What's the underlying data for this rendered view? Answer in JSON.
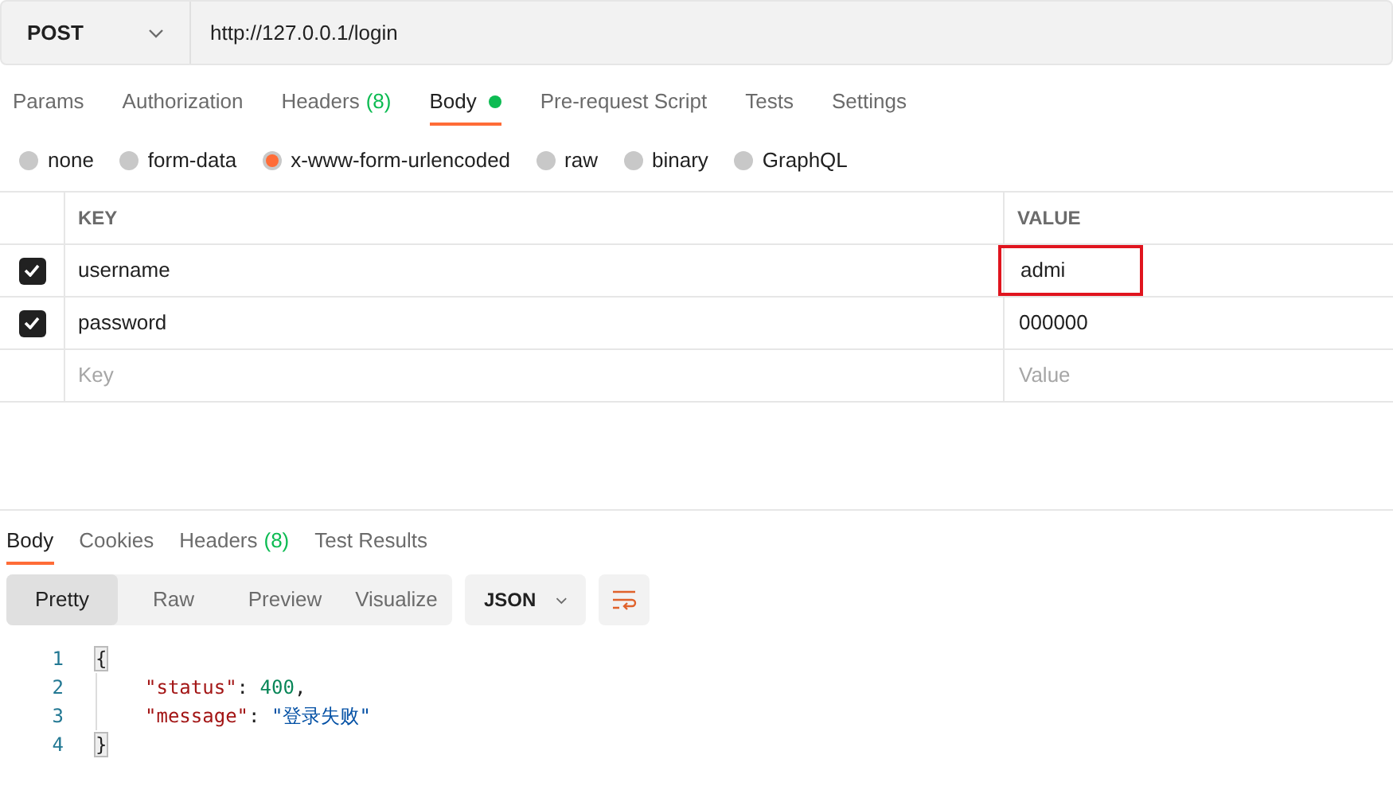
{
  "request": {
    "method": "POST",
    "url": "http://127.0.0.1/login"
  },
  "request_tabs": [
    {
      "label": "Params",
      "dot": false,
      "selected": false
    },
    {
      "label": "Authorization",
      "dot": false,
      "selected": false
    },
    {
      "label": "Headers",
      "count": "(8)",
      "dot": false,
      "selected": false
    },
    {
      "label": "Body",
      "dot": true,
      "selected": true
    },
    {
      "label": "Pre-request Script",
      "dot": false,
      "selected": false
    },
    {
      "label": "Tests",
      "dot": false,
      "selected": false
    },
    {
      "label": "Settings",
      "dot": false,
      "selected": false
    }
  ],
  "body_types": [
    {
      "label": "none",
      "selected": false
    },
    {
      "label": "form-data",
      "selected": false
    },
    {
      "label": "x-www-form-urlencoded",
      "selected": true
    },
    {
      "label": "raw",
      "selected": false
    },
    {
      "label": "binary",
      "selected": false
    },
    {
      "label": "GraphQL",
      "selected": false
    }
  ],
  "table": {
    "columns": [
      "KEY",
      "VALUE"
    ],
    "rows": [
      {
        "checked": true,
        "key": "username",
        "value": "admi",
        "highlighted": true
      },
      {
        "checked": true,
        "key": "password",
        "value": "000000",
        "highlighted": false
      }
    ],
    "new_row": {
      "key_placeholder": "Key",
      "value_placeholder": "Value"
    }
  },
  "response_tabs": [
    {
      "label": "Body",
      "selected": true
    },
    {
      "label": "Cookies",
      "selected": false
    },
    {
      "label": "Headers",
      "count": "(8)",
      "selected": false
    },
    {
      "label": "Test Results",
      "selected": false
    }
  ],
  "view_modes": [
    {
      "label": "Pretty",
      "selected": true
    },
    {
      "label": "Raw",
      "selected": false
    },
    {
      "label": "Preview",
      "selected": false
    },
    {
      "label": "Visualize",
      "selected": false
    }
  ],
  "format": "JSON",
  "code_lines": [
    {
      "number": "1",
      "tokens": [
        {
          "kind": "bracket",
          "text": "{"
        }
      ]
    },
    {
      "number": "2",
      "tokens": [
        {
          "kind": "key",
          "text": "\"status\""
        },
        {
          "kind": "punct",
          "text": ": "
        },
        {
          "kind": "number",
          "text": "400"
        },
        {
          "kind": "punct",
          "text": ","
        }
      ]
    },
    {
      "number": "3",
      "tokens": [
        {
          "kind": "key",
          "text": "\"message\""
        },
        {
          "kind": "punct",
          "text": ": "
        },
        {
          "kind": "string",
          "text": "\"登录失败\""
        }
      ]
    },
    {
      "number": "4",
      "tokens": [
        {
          "kind": "bracket",
          "text": "}"
        }
      ]
    }
  ]
}
